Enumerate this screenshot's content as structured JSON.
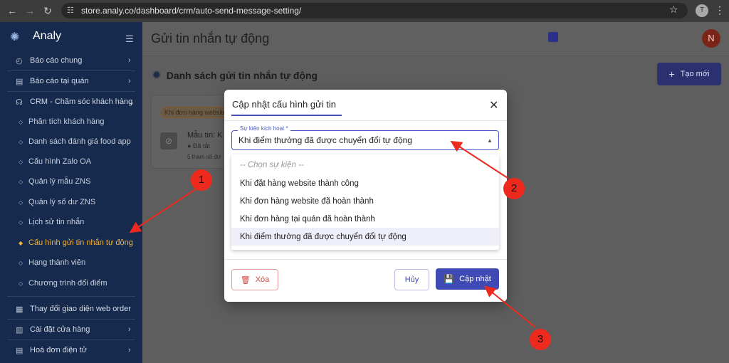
{
  "browser": {
    "url": "store.analy.co/dashboard/crm/auto-send-message-setting/",
    "profile_initial": "T"
  },
  "sidebar": {
    "brand": "Analy",
    "items": [
      {
        "label": "Báo cáo chung",
        "icon": "gauge-icon",
        "has_chevron": true
      },
      {
        "label": "Báo cáo tại quán",
        "icon": "clipboard-icon",
        "has_chevron": true
      },
      {
        "label": "CRM - Chăm sóc khách hàng",
        "icon": "headset-icon",
        "has_chevron": true
      }
    ],
    "crm_subitems": [
      {
        "label": "Phân tích khách hàng"
      },
      {
        "label": "Danh sách đánh giá food app"
      },
      {
        "label": "Cấu hình Zalo OA"
      },
      {
        "label": "Quản lý mẫu ZNS"
      },
      {
        "label": "Quản lý số dư ZNS"
      },
      {
        "label": "Lịch sử tin nhắn"
      },
      {
        "label": "Cấu hình gửi tin nhắn tự động",
        "active": true
      },
      {
        "label": "Hạng thành viên"
      },
      {
        "label": "Chương trình đổi điểm"
      }
    ],
    "bottom_items": [
      {
        "label": "Thay đổi giao diện web order",
        "icon": "layout-icon"
      },
      {
        "label": "Cài đặt cửa hàng",
        "icon": "store-icon",
        "has_chevron": true
      },
      {
        "label": "Hoá đơn điện tử",
        "icon": "invoice-icon",
        "has_chevron": true
      }
    ]
  },
  "header": {
    "title": "Gửi tin nhắn tự động",
    "avatar_initial": "N"
  },
  "main": {
    "section_title": "Danh sách gửi tin nhắn tự động",
    "create_button": "Tạo mới",
    "card": {
      "chip": "Khi đơn hàng website",
      "title": "Mẫu tin: K",
      "status": "Đã tắt",
      "note": "5 tham số đư"
    }
  },
  "modal": {
    "title": "Cập nhật cấu hình gửi tin",
    "field_label": "Sự kiện kích hoạt *",
    "selected_value": "Khi điểm thưởng đã được chuyển đổi tự động",
    "options": [
      {
        "label": "-- Chọn sự kiện --",
        "placeholder": true
      },
      {
        "label": "Khi đặt hàng website thành công"
      },
      {
        "label": "Khi đơn hàng website đã hoàn thành"
      },
      {
        "label": "Khi đơn hàng tại quán đã hoàn thành"
      },
      {
        "label": "Khi điểm thưởng đã được chuyển đổi tự động",
        "selected": true
      }
    ],
    "delete_button": "Xóa",
    "cancel_button": "Hủy",
    "save_button": "Cập nhật"
  },
  "annotations": {
    "step1": "1",
    "step2": "2",
    "step3": "3",
    "color": "#ee2a1e"
  }
}
